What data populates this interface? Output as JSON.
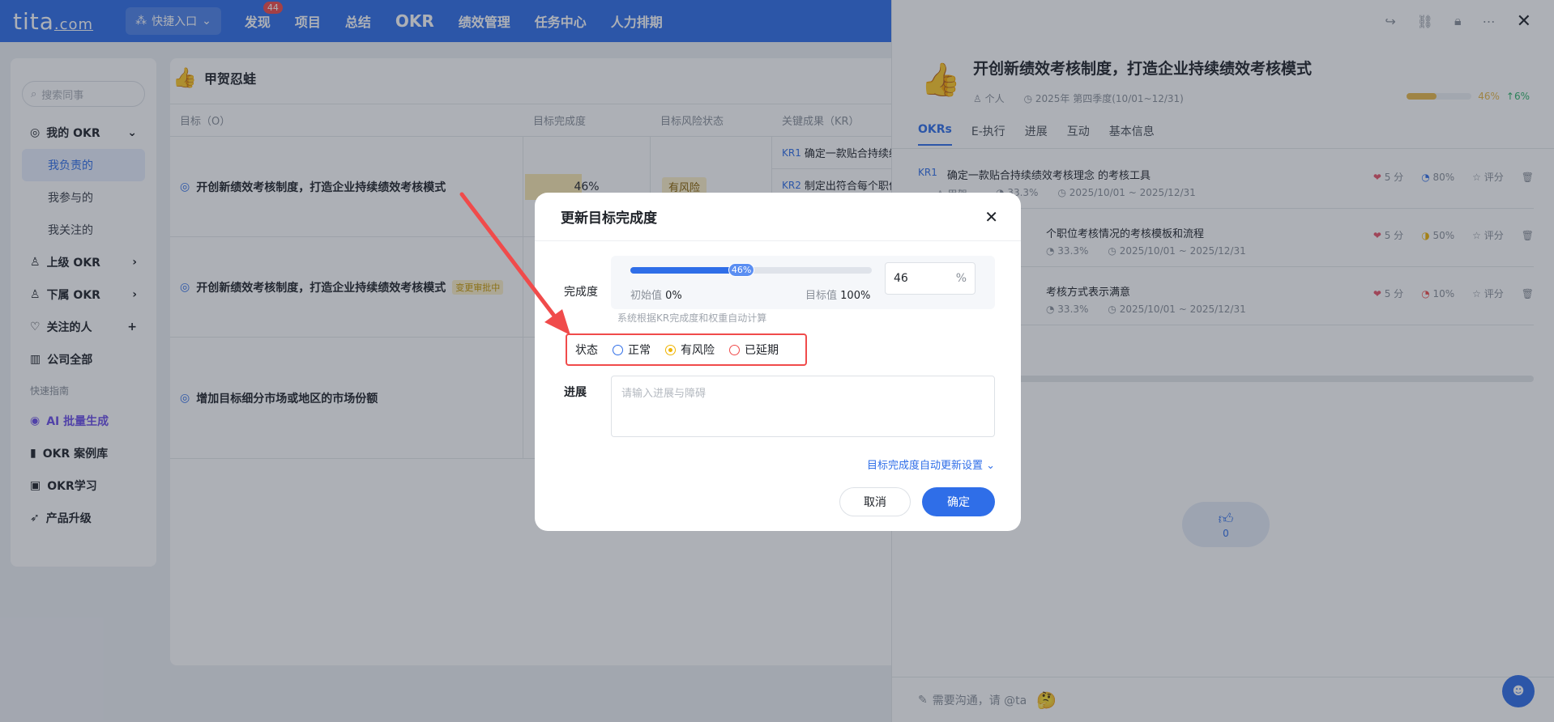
{
  "nav": {
    "logo": "tita",
    "logo_suffix": ".com",
    "quick_entry": "快捷入口",
    "items": [
      "发现",
      "项目",
      "总结",
      "OKR",
      "绩效管理",
      "任务中心",
      "人力排期"
    ],
    "discover_badge": "44"
  },
  "sidebar": {
    "search_placeholder": "搜索同事",
    "my_okr": "我的 OKR",
    "sub": [
      "我负责的",
      "我参与的",
      "我关注的"
    ],
    "upper_okr": "上级 OKR",
    "lower_okr": "下属 OKR",
    "followed": "关注的人",
    "company_all": "公司全部",
    "quick_guide": "快速指南",
    "ai_batch": "AI 批量生成",
    "okr_cases": "OKR 案例库",
    "okr_learn": "OKR学习",
    "product_upgrade": "产品升级"
  },
  "main": {
    "owner": "甲贺忍蛙",
    "headers": {
      "o": "目标（O）",
      "progress": "目标完成度",
      "risk": "目标风险状态",
      "kr": "关键成果（KR）"
    },
    "rows": [
      {
        "title": "开创新绩效考核制度，打造企业持续绩效考核模式",
        "progress": "46%",
        "risk": "有风险",
        "krs": [
          {
            "tag": "KR1",
            "text": "确定一款贴合持续绩"
          },
          {
            "tag": "KR2",
            "text": "制定出符合每个职位"
          }
        ]
      },
      {
        "title": "开创新绩效考核制度，打造企业持续绩效考核模式",
        "review": "变更审批中"
      },
      {
        "title": "增加目标细分市场或地区的市场份额"
      }
    ]
  },
  "drawer": {
    "title": "开创新绩效考核制度，打造企业持续绩效考核模式",
    "type": "个人",
    "period": "2025年 第四季度(10/01~12/31)",
    "progress": "46%",
    "delta": "6%",
    "progress_value": 46,
    "tabs": [
      "OKRs",
      "E-执行",
      "进展",
      "互动",
      "基本信息"
    ],
    "krs": [
      {
        "tag": "KR1",
        "text": "确定一款贴合持续绩效考核理念 的考核工具",
        "owner": "甲贺...",
        "weight": "33.3%",
        "date": "2025/10/01 ~ 2025/12/31",
        "score": "5 分",
        "pct": "80%",
        "rate": "评分"
      },
      {
        "tag": "",
        "text": "个职位考核情况的考核模板和流程",
        "owner": "",
        "weight": "33.3%",
        "date": "2025/10/01 ~ 2025/12/31",
        "score": "5 分",
        "pct": "50%",
        "rate": "评分"
      },
      {
        "tag": "",
        "text": "考核方式表示满意",
        "owner": "",
        "weight": "33.3%",
        "date": "2025/10/01 ~ 2025/12/31",
        "score": "5 分",
        "pct": "10%",
        "rate": "评分"
      }
    ],
    "likes": "0",
    "comment_placeholder": "需要沟通，请 @ta"
  },
  "modal": {
    "title": "更新目标完成度",
    "progress_label": "完成度",
    "progress_value": 46,
    "knob_text": "46%",
    "initial_label": "初始值",
    "initial_value": "0%",
    "target_label": "目标值",
    "target_value": "100%",
    "input_value": "46",
    "unit": "%",
    "hint": "系统根据KR完成度和权重自动计算",
    "status_label": "状态",
    "status_options": [
      "正常",
      "有风险",
      "已延期"
    ],
    "status_selected": "有风险",
    "progress_note_label": "进展",
    "progress_note_placeholder": "请输入进展与障碍",
    "auto_setting": "目标完成度自动更新设置",
    "cancel": "取消",
    "ok": "确定"
  },
  "colors": {
    "brand": "#2f6ee8",
    "risk": "#f0b400",
    "delayed": "#f04b4b",
    "normal": "#2f6ee8"
  }
}
